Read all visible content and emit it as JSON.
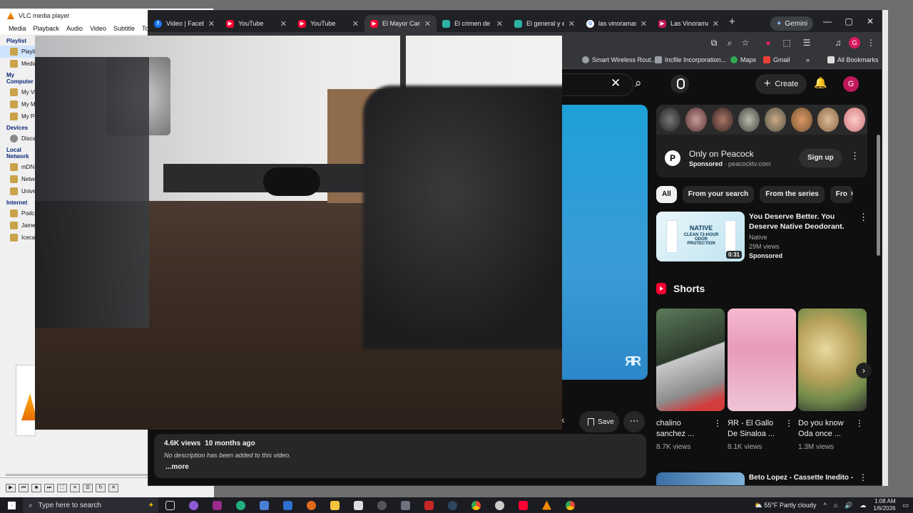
{
  "vlc": {
    "title": "VLC media player",
    "menu": [
      "Media",
      "Playback",
      "Audio",
      "Video",
      "Subtitle",
      "Tools"
    ],
    "sections": [
      {
        "label": "Playlist",
        "items": [
          "Playlist",
          "Media Library"
        ]
      },
      {
        "label": "My Computer",
        "items": [
          "My Videos",
          "My Music",
          "My Pictures"
        ]
      },
      {
        "label": "Devices",
        "items": [
          "Discs"
        ]
      },
      {
        "label": "Local Network",
        "items": [
          "mDNS",
          "Network",
          "Universal"
        ]
      },
      {
        "label": "Internet",
        "items": [
          "Podcasts",
          "Jamendo",
          "Icecast"
        ]
      }
    ]
  },
  "chrome": {
    "tabs": [
      {
        "label": "Video | Facebook",
        "icon": "facebook-icon",
        "color": "#1877f2",
        "active": false
      },
      {
        "label": "YouTube",
        "icon": "youtube-icon",
        "color": "#ff0033",
        "active": false
      },
      {
        "label": "YouTube",
        "icon": "youtube-icon",
        "color": "#ff0033",
        "active": false
      },
      {
        "label": "El Mayor Camar",
        "icon": "youtube-icon",
        "color": "#ff0033",
        "active": true
      },
      {
        "label": "El crimen de la",
        "icon": "doc-icon",
        "color": "#2bb3a3",
        "active": false
      },
      {
        "label": "El general y el",
        "icon": "doc-icon",
        "color": "#2bb3a3",
        "active": false
      },
      {
        "label": "las vinoramas",
        "icon": "google-icon",
        "color": "#9aa0a6",
        "active": false
      },
      {
        "label": "Las Vinoramas",
        "icon": "youtube-icon",
        "color": "#c2185b",
        "active": false
      }
    ],
    "new_tab": "+",
    "gemini": "Gemini",
    "profile_initial": "G",
    "bookmarks": [
      "Smart Wireless Rout...",
      "Incfile Incorporation...",
      "Maps",
      "Gmail"
    ],
    "all_bookmarks": "All Bookmarks"
  },
  "youtube": {
    "create_label": "Create",
    "avatar_initial": "G",
    "poster_logo": "ЯR",
    "share_tail": "k",
    "save_label": "Save",
    "description": {
      "views": "4.6K views",
      "date": "10 months ago",
      "text": "No description has been added to this video.",
      "more": "...more"
    },
    "peacock_ad": {
      "title": "Only on Peacock",
      "sponsored": "Sponsored",
      "domain": "peacocktv.com",
      "cta": "Sign up",
      "logo": "P"
    },
    "chips": [
      "All",
      "From your search",
      "From the series",
      "Fro"
    ],
    "native_ad": {
      "title": "You Deserve Better. You Deserve Native Deodorant.",
      "channel": "Native",
      "views": "29M views",
      "sponsored": "Sponsored",
      "duration": "0:31",
      "brand": "NATIVE",
      "claim": "CLEAN 72-HOUR ODOR PROTECTION"
    },
    "shorts_label": "Shorts",
    "shorts": [
      {
        "title": "chalino sanchez ...",
        "views": "8.7K views"
      },
      {
        "title": "ЯR - El Gallo De Sinaloa ...",
        "views": "8.1K views"
      },
      {
        "title": "Do you know Oda once ...",
        "views": "1.3M views"
      }
    ],
    "next_video_title": "Beto Lopez - Cassette Inedito -"
  },
  "taskbar": {
    "search_placeholder": "Type here to search",
    "weather": "55°F  Partly cloudy",
    "time": "1:08 AM",
    "date": "1/6/2026"
  }
}
